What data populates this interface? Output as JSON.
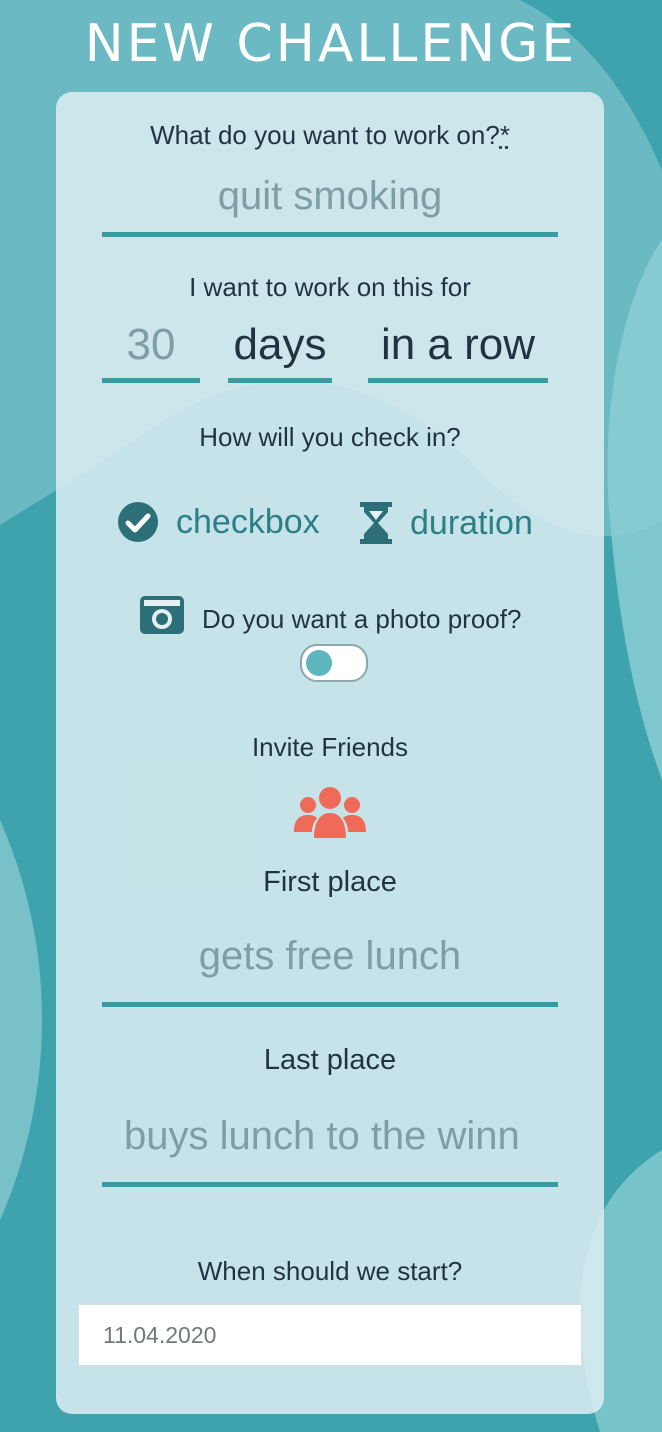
{
  "header": {
    "title": "NEW CHALLENGE"
  },
  "form": {
    "work_on_label": "What do you want to work on?",
    "required_mark": "*",
    "work_on_placeholder": "quit smoking",
    "duration_label": "I want to work on this for",
    "duration_value": "30",
    "duration_unit": "days",
    "duration_mode": "in a row",
    "checkin_label": "How will you check in?",
    "checkin_options": [
      {
        "label": "checkbox",
        "icon": "check-circle-icon"
      },
      {
        "label": "duration",
        "icon": "hourglass-icon"
      }
    ],
    "photo_label": "Do you want a photo proof?",
    "photo_toggle_on": false,
    "invite_label": "Invite Friends",
    "first_place_label": "First place",
    "first_place_placeholder": "gets free lunch",
    "last_place_label": "Last place",
    "last_place_placeholder": "buys lunch to the winn",
    "start_label": "When should we start?",
    "start_date": "11.04.2020"
  },
  "colors": {
    "background": "#3ea3ad",
    "accent": "#3a9aa2",
    "invite_icon": "#ef6b57"
  }
}
